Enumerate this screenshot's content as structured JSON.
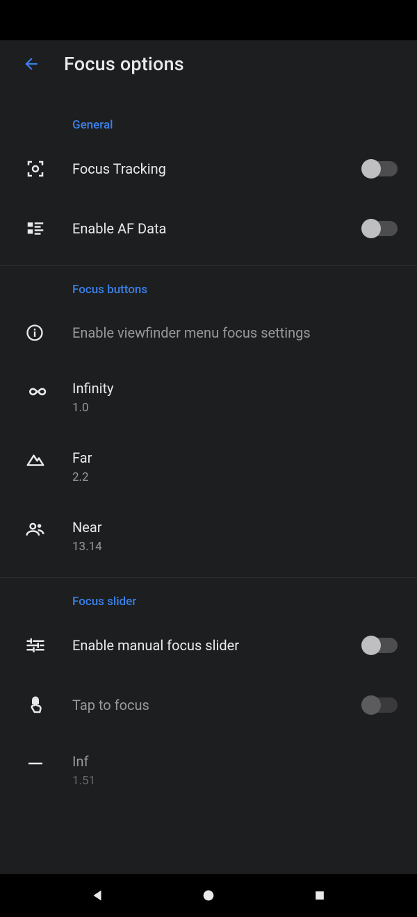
{
  "header": {
    "title": "Focus options"
  },
  "sections": {
    "general": {
      "header": "General",
      "focus_tracking": "Focus Tracking",
      "enable_af_data": "Enable AF Data"
    },
    "focus_buttons": {
      "header": "Focus buttons",
      "hint": "Enable viewfinder menu focus settings",
      "infinity_label": "Infinity",
      "infinity_value": "1.0",
      "far_label": "Far",
      "far_value": "2.2",
      "near_label": "Near",
      "near_value": "13.14"
    },
    "focus_slider": {
      "header": "Focus slider",
      "enable_manual": "Enable manual focus slider",
      "tap_to_focus": "Tap to focus",
      "inf_label": "Inf",
      "inf_value": "1.51"
    }
  }
}
